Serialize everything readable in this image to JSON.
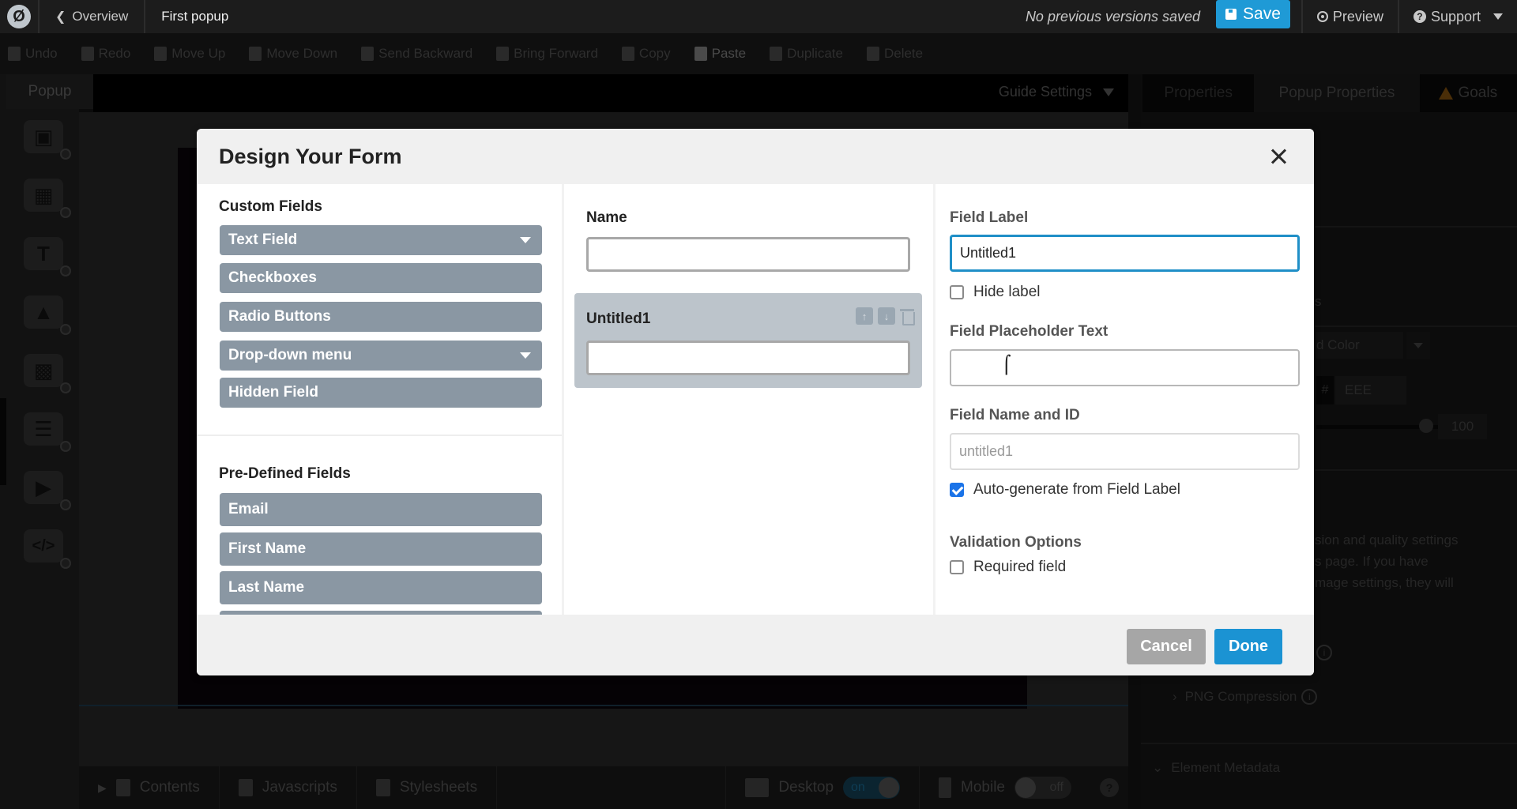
{
  "topbar": {
    "logo_glyph": "Ø",
    "back_label": "Overview",
    "page_name": "First popup",
    "versions_status": "No previous versions saved",
    "save_label": "Save",
    "preview_label": "Preview",
    "support_label": "Support"
  },
  "toolbar": {
    "items": [
      "Undo",
      "Redo",
      "Move Up",
      "Move Down",
      "Send Backward",
      "Bring Forward",
      "Copy",
      "Paste",
      "Duplicate",
      "Delete"
    ]
  },
  "left_rail": {
    "tab_label": "Popup",
    "tools": [
      "box-icon",
      "section-icon",
      "text-icon",
      "image-icon",
      "button-icon",
      "form-icon",
      "video-icon",
      "code-icon"
    ]
  },
  "canvas": {
    "guide_settings_label": "Guide Settings"
  },
  "bottom_bar": {
    "contents_label": "Contents",
    "javascripts_label": "Javascripts",
    "stylesheets_label": "Stylesheets",
    "desktop_label": "Desktop",
    "desktop_toggle": "on",
    "mobile_label": "Mobile",
    "mobile_toggle": "off",
    "help_glyph": "?"
  },
  "right_panel": {
    "tabs": [
      "Properties",
      "Popup Properties",
      "Goals"
    ],
    "section_partial": "s",
    "color_select": "d Color",
    "hex_hash": "#",
    "hex_value": "EEE",
    "opacity_value": "100",
    "desc_line1": "sion and quality settings",
    "desc_line2": "s page. If you have",
    "desc_line3": "mage settings, they will",
    "png_compression_label": "PNG Compression",
    "element_metadata_label": "Element Metadata"
  },
  "modal": {
    "title": "Design Your Form",
    "custom_fields_title": "Custom Fields",
    "custom_fields": [
      {
        "label": "Text Field",
        "has_dropdown": true
      },
      {
        "label": "Checkboxes",
        "has_dropdown": false
      },
      {
        "label": "Radio Buttons",
        "has_dropdown": false
      },
      {
        "label": "Drop-down menu",
        "has_dropdown": true
      },
      {
        "label": "Hidden Field",
        "has_dropdown": false
      }
    ],
    "predefined_fields_title": "Pre-Defined Fields",
    "predefined_fields": [
      "Email",
      "First Name",
      "Last Name",
      ""
    ],
    "form_preview": {
      "fields": [
        {
          "label": "Name",
          "value": ""
        },
        {
          "label": "Untitled1",
          "value": "",
          "selected": true
        }
      ]
    },
    "properties": {
      "field_label_title": "Field Label",
      "field_label_value": "Untitled1",
      "hide_label": "Hide label",
      "hide_label_checked": false,
      "placeholder_title": "Field Placeholder Text",
      "placeholder_value": "",
      "name_id_title": "Field Name and ID",
      "name_id_value": "untitled1",
      "autogenerate_label": "Auto-generate from Field Label",
      "autogenerate_checked": true,
      "validation_title": "Validation Options",
      "required_label": "Required field",
      "required_checked": false
    },
    "cancel_label": "Cancel",
    "done_label": "Done"
  },
  "colors": {
    "accent": "#1f9ad6",
    "field_button": "#8a97a3",
    "selected_field_bg": "#bcc4cb",
    "cancel": "#a6a6a6",
    "checkbox_checked": "#1a73e8"
  }
}
